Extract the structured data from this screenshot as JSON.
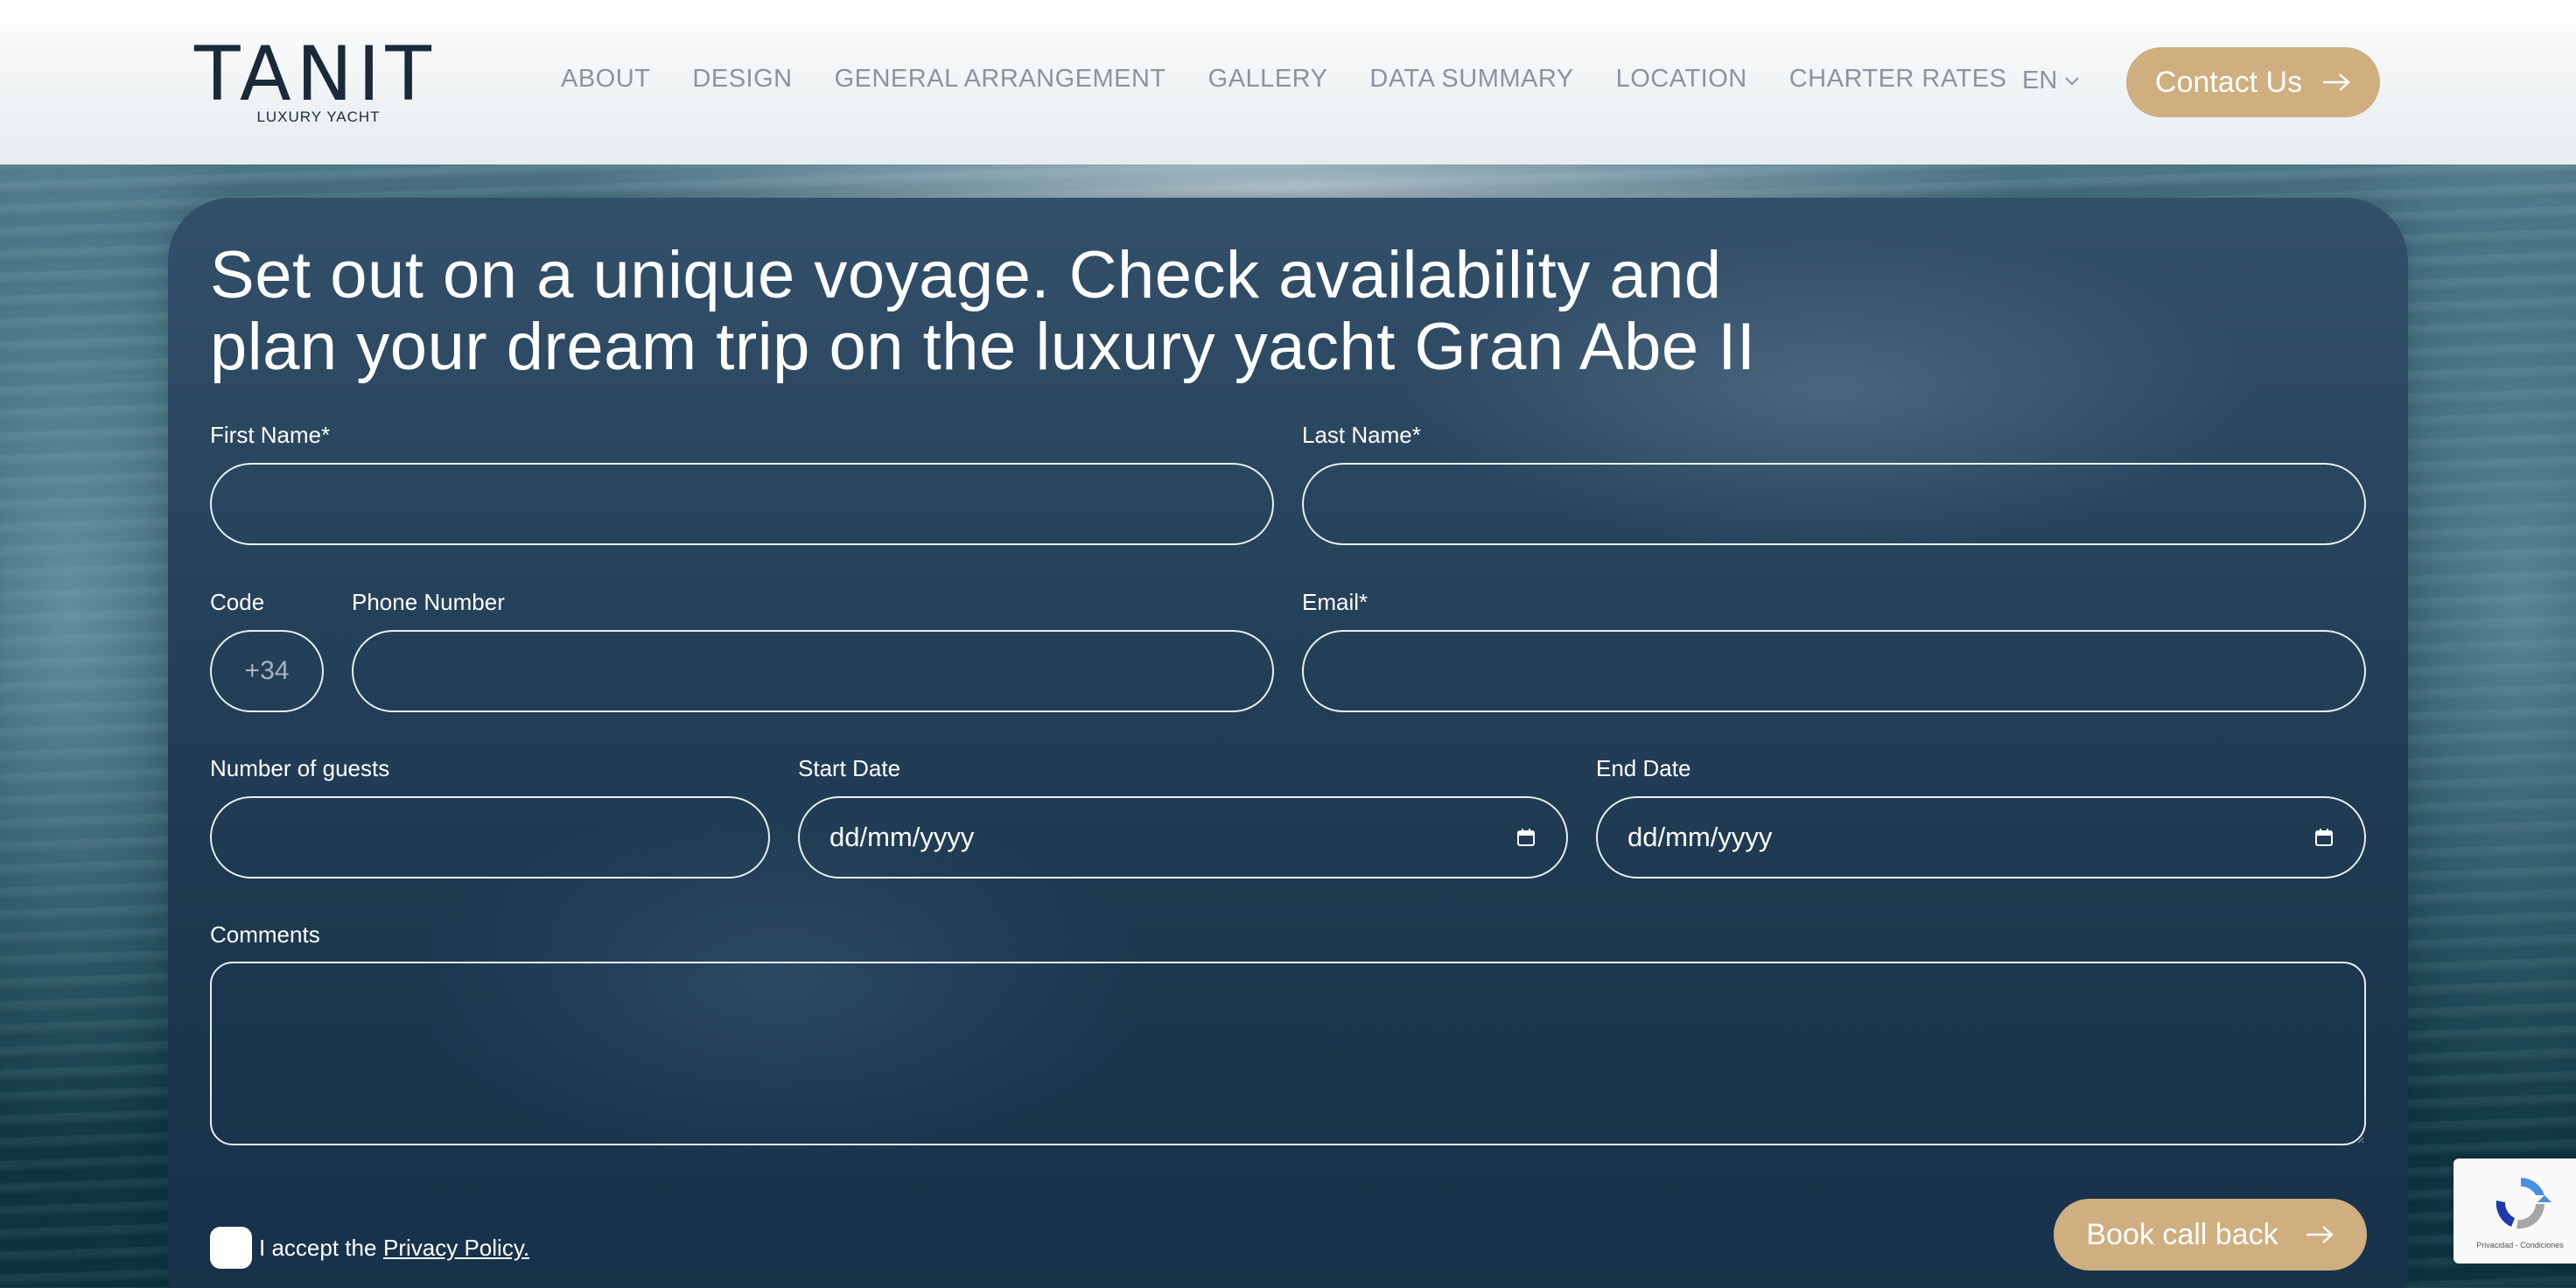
{
  "header": {
    "logo_text": "TANIT",
    "logo_subtitle": "LUXURY YACHT",
    "nav": [
      "ABOUT",
      "DESIGN",
      "GENERAL ARRANGEMENT",
      "GALLERY",
      "DATA SUMMARY",
      "LOCATION",
      "CHARTER RATES"
    ],
    "language": "EN",
    "contact_label": "Contact Us"
  },
  "form": {
    "title": "Set out on a unique voyage. Check availability and plan your dream trip on the luxury yacht Gran Abe II",
    "first_name_label": "First Name*",
    "last_name_label": "Last Name*",
    "code_label": "Code",
    "code_placeholder": "+34",
    "phone_label": "Phone Number",
    "email_label": "Email*",
    "guests_label": "Number of guests",
    "start_date_label": "Start Date",
    "start_date_value": "dd/mm/yyyy",
    "end_date_label": "End Date",
    "end_date_value": "dd/mm/yyyy",
    "comments_label": "Comments",
    "accept_text": "I accept the",
    "privacy_link": "Privacy Policy.",
    "submit_label": "Book call back"
  },
  "recaptcha": {
    "footer_text": "Privacidad - Condiciones"
  },
  "colors": {
    "accent": "#cfae80",
    "card": "#243f58",
    "nav_text": "#8a94a0",
    "logo": "#1b2a3a"
  }
}
